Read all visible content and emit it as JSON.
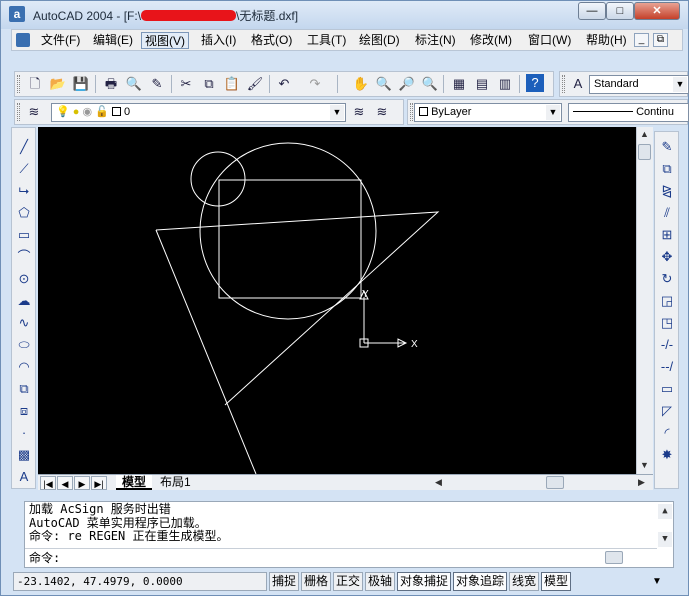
{
  "window": {
    "app_icon": "a",
    "title_prefix": "AutoCAD 2004 - [F:\\",
    "title_suffix": "\\无标题.dxf]",
    "controls": {
      "minimize": "—",
      "maximize": "□",
      "close": "✕"
    }
  },
  "menubar": {
    "items": [
      {
        "label": "文件(F)"
      },
      {
        "label": "编辑(E)"
      },
      {
        "label": "视图(V)"
      },
      {
        "label": "插入(I)"
      },
      {
        "label": "格式(O)"
      },
      {
        "label": "工具(T)"
      },
      {
        "label": "绘图(D)"
      },
      {
        "label": "标注(N)"
      },
      {
        "label": "修改(M)"
      },
      {
        "label": "窗口(W)"
      },
      {
        "label": "帮助(H)"
      }
    ],
    "active_index": 2,
    "mdi_controls": {
      "minimize": "_",
      "restore": "⧉"
    }
  },
  "standard_toolbar": {
    "icons": [
      "new-icon",
      "open-icon",
      "save-icon",
      "print-icon",
      "preview-icon",
      "publish-icon",
      "cut-icon",
      "copy-icon",
      "paste-icon",
      "match-properties-icon",
      "undo-icon",
      "redo-icon",
      "pan-icon",
      "zoom-realtime-icon",
      "zoom-window-icon",
      "zoom-previous-icon",
      "properties-icon",
      "design-center-icon",
      "tool-palettes-icon",
      "help-icon"
    ],
    "text_style_value": "Standard"
  },
  "layers_toolbar": {
    "layer_value": "0",
    "color_value": "ByLayer",
    "linetype_value": "Continu"
  },
  "draw_toolbar": [
    "line-icon",
    "construction-line-icon",
    "polyline-icon",
    "polygon-icon",
    "rectangle-icon",
    "arc-icon",
    "circle-icon",
    "revision-cloud-icon",
    "spline-icon",
    "ellipse-icon",
    "ellipse-arc-icon",
    "insert-block-icon",
    "make-block-icon",
    "point-icon",
    "hatch-icon",
    "multiline-text-icon"
  ],
  "modify_toolbar": [
    "erase-icon",
    "copy-object-icon",
    "mirror-icon",
    "offset-icon",
    "array-icon",
    "move-icon",
    "rotate-icon",
    "scale-icon",
    "stretch-icon",
    "trim-icon",
    "extend-icon",
    "break-icon",
    "chamfer-icon",
    "fillet-icon",
    "explode-icon"
  ],
  "tabs": {
    "items": [
      {
        "label": "模型"
      },
      {
        "label": "布局1"
      }
    ],
    "active_index": 0
  },
  "drawing": {
    "ucs_x_label": "X",
    "ucs_y_label": "Y",
    "line_color": "#ffffff"
  },
  "command": {
    "history": [
      "加载 AcSign 服务时出错",
      "AutoCAD 菜单实用程序已加载。",
      "命令: re REGEN 正在重生成模型。"
    ],
    "prompt": "命令:"
  },
  "status": {
    "coordinates": "-23.1402, 47.4979, 0.0000",
    "toggles": [
      {
        "label": "捕捉",
        "on": false
      },
      {
        "label": "栅格",
        "on": false
      },
      {
        "label": "正交",
        "on": false
      },
      {
        "label": "极轴",
        "on": false
      },
      {
        "label": "对象捕捉",
        "on": true
      },
      {
        "label": "对象追踪",
        "on": true
      },
      {
        "label": "线宽",
        "on": false
      },
      {
        "label": "模型",
        "on": true
      }
    ]
  }
}
